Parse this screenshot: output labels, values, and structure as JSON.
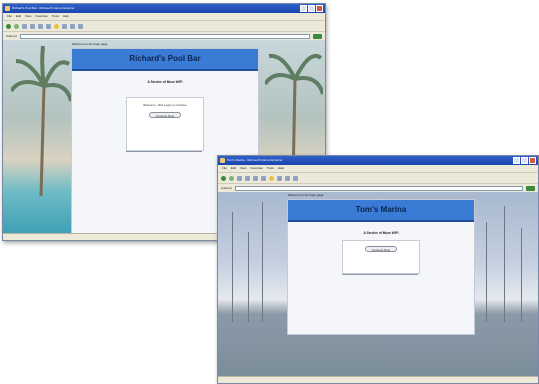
{
  "window_a": {
    "title": "Richard's Pool Bar - Microsoft Internet Explorer",
    "menu": [
      "File",
      "Edit",
      "View",
      "Favorites",
      "Tools",
      "Help"
    ],
    "address_label": "Address",
    "page": {
      "caption": "Welcome to the login page",
      "heading": "Richard's Pool Bar",
      "subtitle": "A Service of Muse WiFi",
      "login_text": "Welcome, click Login to continue",
      "login_button": "Connect Now",
      "note": "",
      "footer": ""
    }
  },
  "window_b": {
    "title": "Tom's Marina - Microsoft Internet Explorer",
    "menu": [
      "File",
      "Edit",
      "View",
      "Favorites",
      "Tools",
      "Help"
    ],
    "address_label": "Address",
    "page": {
      "caption": "Welcome to the login page",
      "heading": "Tom's Marina",
      "subtitle": "A Service of Muse WiFi",
      "login_text": "",
      "login_button": "Connect Now",
      "note": "",
      "footer": ""
    }
  }
}
